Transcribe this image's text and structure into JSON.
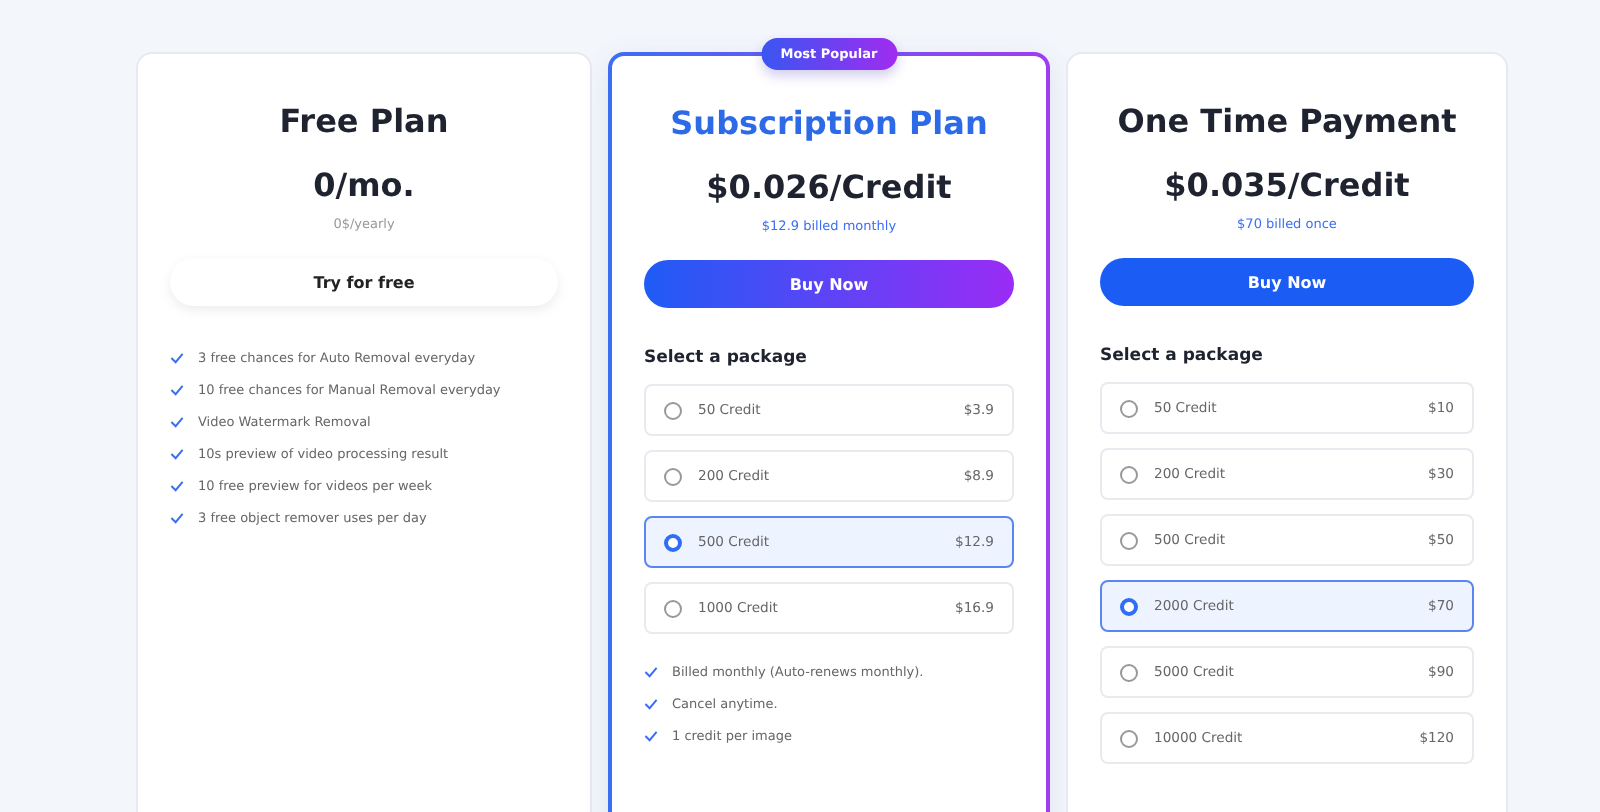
{
  "plans": [
    {
      "kind": "free",
      "featured": false,
      "title": "Free Plan",
      "price": "0/mo.",
      "billing": "0$/yearly",
      "button": "Try for free",
      "features": [
        "3 free chances for Auto Removal everyday",
        "10 free chances for Manual Removal everyday",
        "Video Watermark Removal",
        "10s preview of video processing result",
        "10 free preview for videos per week",
        "3 free object remover uses per day"
      ]
    },
    {
      "kind": "paid",
      "featured": true,
      "badge": "Most Popular",
      "title": "Subscription Plan",
      "price": "$0.026/Credit",
      "billing": "$12.9 billed monthly",
      "button": "Buy Now",
      "packages_heading": "Select a package",
      "packages": [
        {
          "name": "50 Credit",
          "price": "$3.9",
          "selected": false
        },
        {
          "name": "200 Credit",
          "price": "$8.9",
          "selected": false
        },
        {
          "name": "500 Credit",
          "price": "$12.9",
          "selected": true
        },
        {
          "name": "1000 Credit",
          "price": "$16.9",
          "selected": false
        }
      ],
      "features": [
        "Billed monthly (Auto-renews monthly).",
        "Cancel anytime.",
        "1 credit per image"
      ]
    },
    {
      "kind": "paid",
      "featured": false,
      "title": "One Time Payment",
      "price": "$0.035/Credit",
      "billing": "$70 billed once",
      "button": "Buy Now",
      "packages_heading": "Select a package",
      "packages": [
        {
          "name": "50 Credit",
          "price": "$10",
          "selected": false
        },
        {
          "name": "200 Credit",
          "price": "$30",
          "selected": false
        },
        {
          "name": "500 Credit",
          "price": "$50",
          "selected": false
        },
        {
          "name": "2000 Credit",
          "price": "$70",
          "selected": true
        },
        {
          "name": "5000 Credit",
          "price": "$90",
          "selected": false
        },
        {
          "name": "10000 Credit",
          "price": "$120",
          "selected": false
        }
      ]
    }
  ]
}
